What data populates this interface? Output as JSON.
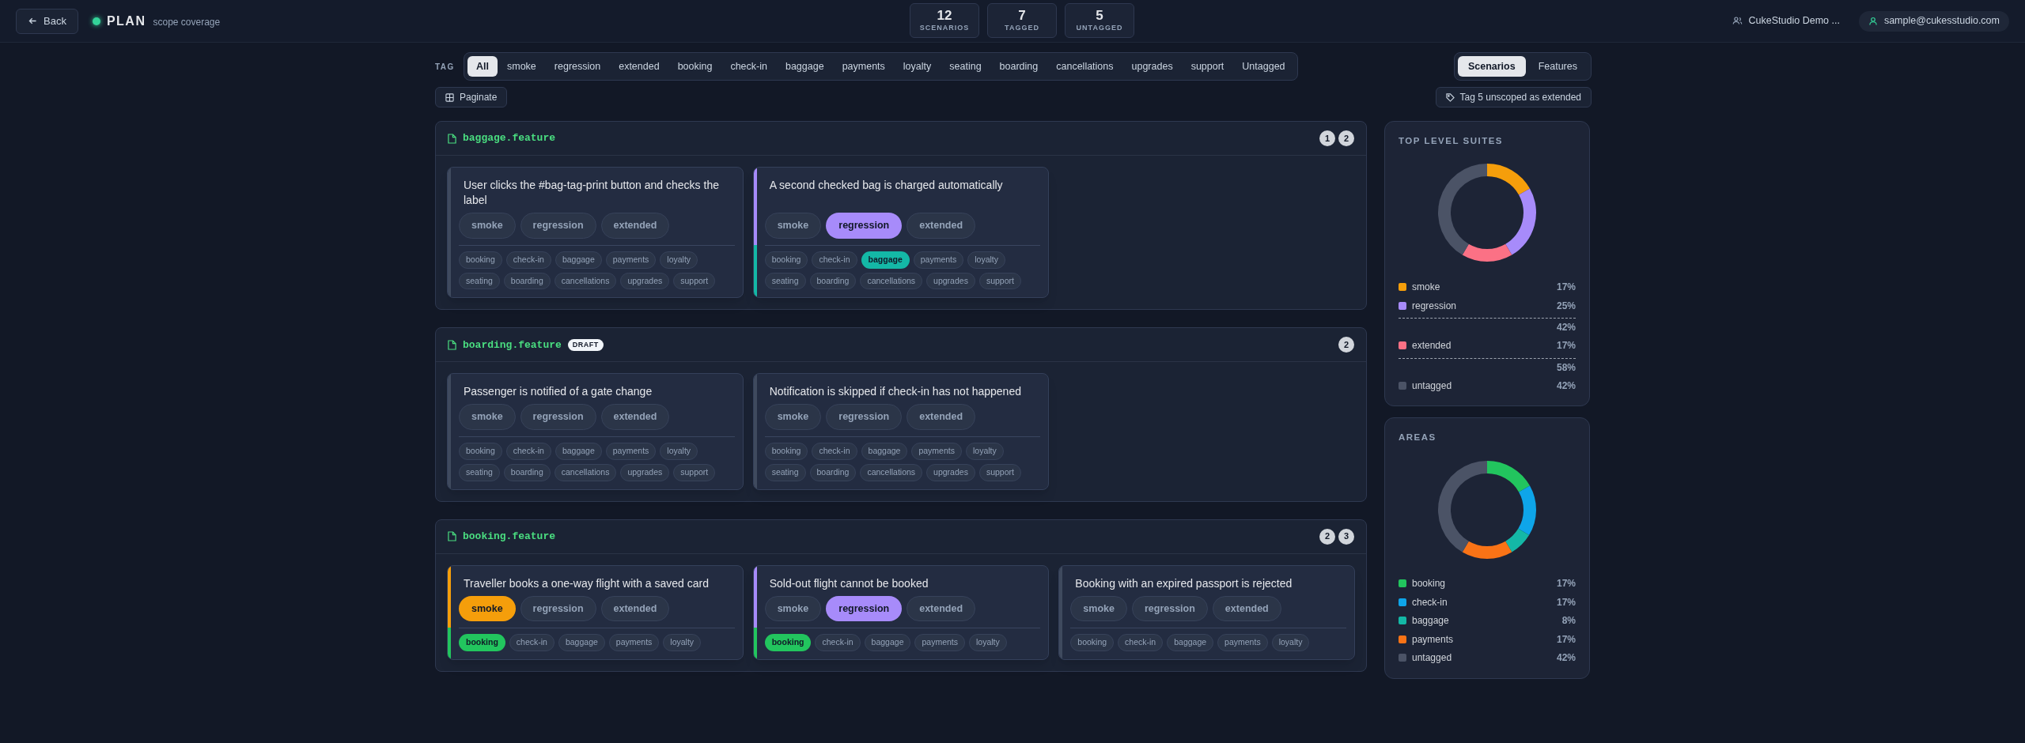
{
  "header": {
    "back": "Back",
    "title": "PLAN",
    "subtitle": "scope coverage",
    "stats": [
      {
        "value": "12",
        "label": "SCENARIOS"
      },
      {
        "value": "7",
        "label": "TAGGED"
      },
      {
        "value": "5",
        "label": "UNTAGGED"
      }
    ],
    "workspace": "CukeStudio Demo ...",
    "user": "sample@cukesstudio.com"
  },
  "filters": {
    "label": "TAG",
    "tags": [
      {
        "label": "All",
        "selected": true
      },
      {
        "label": "smoke",
        "selected": false
      },
      {
        "label": "regression",
        "selected": false
      },
      {
        "label": "extended",
        "selected": false
      },
      {
        "label": "booking",
        "selected": false
      },
      {
        "label": "check-in",
        "selected": false
      },
      {
        "label": "baggage",
        "selected": false
      },
      {
        "label": "payments",
        "selected": false
      },
      {
        "label": "loyalty",
        "selected": false
      },
      {
        "label": "seating",
        "selected": false
      },
      {
        "label": "boarding",
        "selected": false
      },
      {
        "label": "cancellations",
        "selected": false
      },
      {
        "label": "upgrades",
        "selected": false
      },
      {
        "label": "support",
        "selected": false
      },
      {
        "label": "Untagged",
        "selected": false
      }
    ],
    "views": [
      {
        "label": "Scenarios",
        "selected": true
      },
      {
        "label": "Features",
        "selected": false
      }
    ],
    "paginate": "Paginate",
    "bulk_action": "Tag 5 unscoped as extended"
  },
  "features": [
    {
      "name": "baggage.feature",
      "draft": false,
      "pages": [
        "1",
        "2"
      ],
      "scenarios": [
        {
          "title": "User clicks the #bag-tag-print button and checks the label",
          "suites": [
            {
              "label": "smoke",
              "selected": false
            },
            {
              "label": "regression",
              "selected": false
            },
            {
              "label": "extended",
              "selected": false
            }
          ],
          "areas": [
            {
              "label": "booking",
              "selected": false
            },
            {
              "label": "check-in",
              "selected": false
            },
            {
              "label": "baggage",
              "selected": false
            },
            {
              "label": "payments",
              "selected": false
            },
            {
              "label": "loyalty",
              "selected": false
            },
            {
              "label": "seating",
              "selected": false
            },
            {
              "label": "boarding",
              "selected": false
            },
            {
              "label": "cancellations",
              "selected": false
            },
            {
              "label": "upgrades",
              "selected": false
            },
            {
              "label": "support",
              "selected": false
            }
          ]
        },
        {
          "title": "A second checked bag is charged automatically",
          "suites": [
            {
              "label": "smoke",
              "selected": false
            },
            {
              "label": "regression",
              "selected": true
            },
            {
              "label": "extended",
              "selected": false
            }
          ],
          "areas": [
            {
              "label": "booking",
              "selected": false
            },
            {
              "label": "check-in",
              "selected": false
            },
            {
              "label": "baggage",
              "selected": true
            },
            {
              "label": "payments",
              "selected": false
            },
            {
              "label": "loyalty",
              "selected": false
            },
            {
              "label": "seating",
              "selected": false
            },
            {
              "label": "boarding",
              "selected": false
            },
            {
              "label": "cancellations",
              "selected": false
            },
            {
              "label": "upgrades",
              "selected": false
            },
            {
              "label": "support",
              "selected": false
            }
          ]
        }
      ]
    },
    {
      "name": "boarding.feature",
      "draft": true,
      "draft_label": "DRAFT",
      "pages": [
        "2"
      ],
      "scenarios": [
        {
          "title": "Passenger is notified of a gate change",
          "suites": [
            {
              "label": "smoke",
              "selected": false
            },
            {
              "label": "regression",
              "selected": false
            },
            {
              "label": "extended",
              "selected": false
            }
          ],
          "areas": [
            {
              "label": "booking",
              "selected": false
            },
            {
              "label": "check-in",
              "selected": false
            },
            {
              "label": "baggage",
              "selected": false
            },
            {
              "label": "payments",
              "selected": false
            },
            {
              "label": "loyalty",
              "selected": false
            },
            {
              "label": "seating",
              "selected": false
            },
            {
              "label": "boarding",
              "selected": false
            },
            {
              "label": "cancellations",
              "selected": false
            },
            {
              "label": "upgrades",
              "selected": false
            },
            {
              "label": "support",
              "selected": false
            }
          ]
        },
        {
          "title": "Notification is skipped if check-in has not happened",
          "suites": [
            {
              "label": "smoke",
              "selected": false
            },
            {
              "label": "regression",
              "selected": false
            },
            {
              "label": "extended",
              "selected": false
            }
          ],
          "areas": [
            {
              "label": "booking",
              "selected": false
            },
            {
              "label": "check-in",
              "selected": false
            },
            {
              "label": "baggage",
              "selected": false
            },
            {
              "label": "payments",
              "selected": false
            },
            {
              "label": "loyalty",
              "selected": false
            },
            {
              "label": "seating",
              "selected": false
            },
            {
              "label": "boarding",
              "selected": false
            },
            {
              "label": "cancellations",
              "selected": false
            },
            {
              "label": "upgrades",
              "selected": false
            },
            {
              "label": "support",
              "selected": false
            }
          ]
        }
      ]
    },
    {
      "name": "booking.feature",
      "draft": false,
      "pages": [
        "2",
        "3"
      ],
      "scenarios": [
        {
          "title": "Traveller books a one-way flight with a saved card",
          "suites": [
            {
              "label": "smoke",
              "selected": true
            },
            {
              "label": "regression",
              "selected": false
            },
            {
              "label": "extended",
              "selected": false
            }
          ],
          "areas": [
            {
              "label": "booking",
              "selected": true
            },
            {
              "label": "check-in",
              "selected": false
            },
            {
              "label": "baggage",
              "selected": false
            },
            {
              "label": "payments",
              "selected": false
            },
            {
              "label": "loyalty",
              "selected": false
            }
          ]
        },
        {
          "title": "Sold-out flight cannot be booked",
          "suites": [
            {
              "label": "smoke",
              "selected": false
            },
            {
              "label": "regression",
              "selected": true
            },
            {
              "label": "extended",
              "selected": false
            }
          ],
          "areas": [
            {
              "label": "booking",
              "selected": true
            },
            {
              "label": "check-in",
              "selected": false
            },
            {
              "label": "baggage",
              "selected": false
            },
            {
              "label": "payments",
              "selected": false
            },
            {
              "label": "loyalty",
              "selected": false
            }
          ]
        },
        {
          "title": "Booking with an expired passport is rejected",
          "suites": [
            {
              "label": "smoke",
              "selected": false
            },
            {
              "label": "regression",
              "selected": false
            },
            {
              "label": "extended",
              "selected": false
            }
          ],
          "areas": [
            {
              "label": "booking",
              "selected": false
            },
            {
              "label": "check-in",
              "selected": false
            },
            {
              "label": "baggage",
              "selected": false
            },
            {
              "label": "payments",
              "selected": false
            },
            {
              "label": "loyalty",
              "selected": false
            }
          ]
        }
      ]
    }
  ],
  "panels": [
    {
      "title": "TOP LEVEL SUITES",
      "chart_data": {
        "type": "donut",
        "categories": [
          "smoke",
          "regression",
          "extended",
          "untagged"
        ],
        "values": [
          17,
          25,
          17,
          42
        ]
      },
      "legend": [
        {
          "kind": "item",
          "value": "17%",
          "color": "#f59e0b"
        },
        {
          "kind": "item",
          "value": "25%",
          "color": "#a78bfa"
        },
        {
          "kind": "subtotal",
          "value": "42%"
        },
        {
          "kind": "item",
          "value": "17%",
          "color": "#fb7185"
        },
        {
          "kind": "subtotal",
          "value": "58%"
        },
        {
          "kind": "item",
          "value": "42%",
          "color": "#4b5366"
        }
      ]
    },
    {
      "title": "AREAS",
      "chart_data": {
        "type": "donut",
        "categories": [
          "booking",
          "check-in",
          "baggage",
          "payments",
          "untagged"
        ],
        "values": [
          17,
          17,
          8,
          17,
          42
        ]
      },
      "legend": [
        {
          "kind": "item",
          "value": "17%",
          "color": "#22c55e"
        },
        {
          "kind": "item",
          "value": "17%",
          "color": "#0ea5e9"
        },
        {
          "kind": "item",
          "value": "8%",
          "color": "#14b8a6"
        },
        {
          "kind": "item",
          "value": "17%",
          "color": "#f97316"
        },
        {
          "kind": "item",
          "value": "42%",
          "color": "#4b5366"
        }
      ]
    }
  ]
}
